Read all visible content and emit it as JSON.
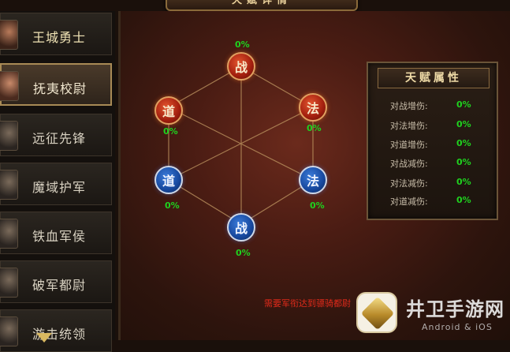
{
  "header": {
    "title": "天赋详情"
  },
  "sidebar": {
    "items": [
      {
        "label": "王城勇士"
      },
      {
        "label": "抚夷校尉"
      },
      {
        "label": "远征先锋"
      },
      {
        "label": "魔域护军"
      },
      {
        "label": "铁血军侯"
      },
      {
        "label": "破军都尉"
      },
      {
        "label": "游击统领"
      }
    ],
    "selected_index": 1
  },
  "talent_graph": {
    "nodes": [
      {
        "label": "战",
        "percent": "0%",
        "color": "red"
      },
      {
        "label": "法",
        "percent": "0%",
        "color": "red"
      },
      {
        "label": "道",
        "percent": "0%",
        "color": "red"
      },
      {
        "label": "道",
        "percent": "0%",
        "color": "blue"
      },
      {
        "label": "法",
        "percent": "0%",
        "color": "blue"
      },
      {
        "label": "战",
        "percent": "0%",
        "color": "blue"
      }
    ]
  },
  "attributes": {
    "title": "天赋属性",
    "rows": [
      {
        "label": "对战增伤:",
        "value": "0%"
      },
      {
        "label": "对法增伤:",
        "value": "0%"
      },
      {
        "label": "对道增伤:",
        "value": "0%"
      },
      {
        "label": "对战减伤:",
        "value": "0%"
      },
      {
        "label": "对法减伤:",
        "value": "0%"
      },
      {
        "label": "对道减伤:",
        "value": "0%"
      }
    ]
  },
  "notice": "需要军衔达到骠骑都尉",
  "watermark": {
    "text": "井卫手游网",
    "sub": "Android & iOS"
  },
  "colors": {
    "accent_red": "#c9341a",
    "accent_blue": "#1f5cbf",
    "value_green": "#1fd21f"
  }
}
